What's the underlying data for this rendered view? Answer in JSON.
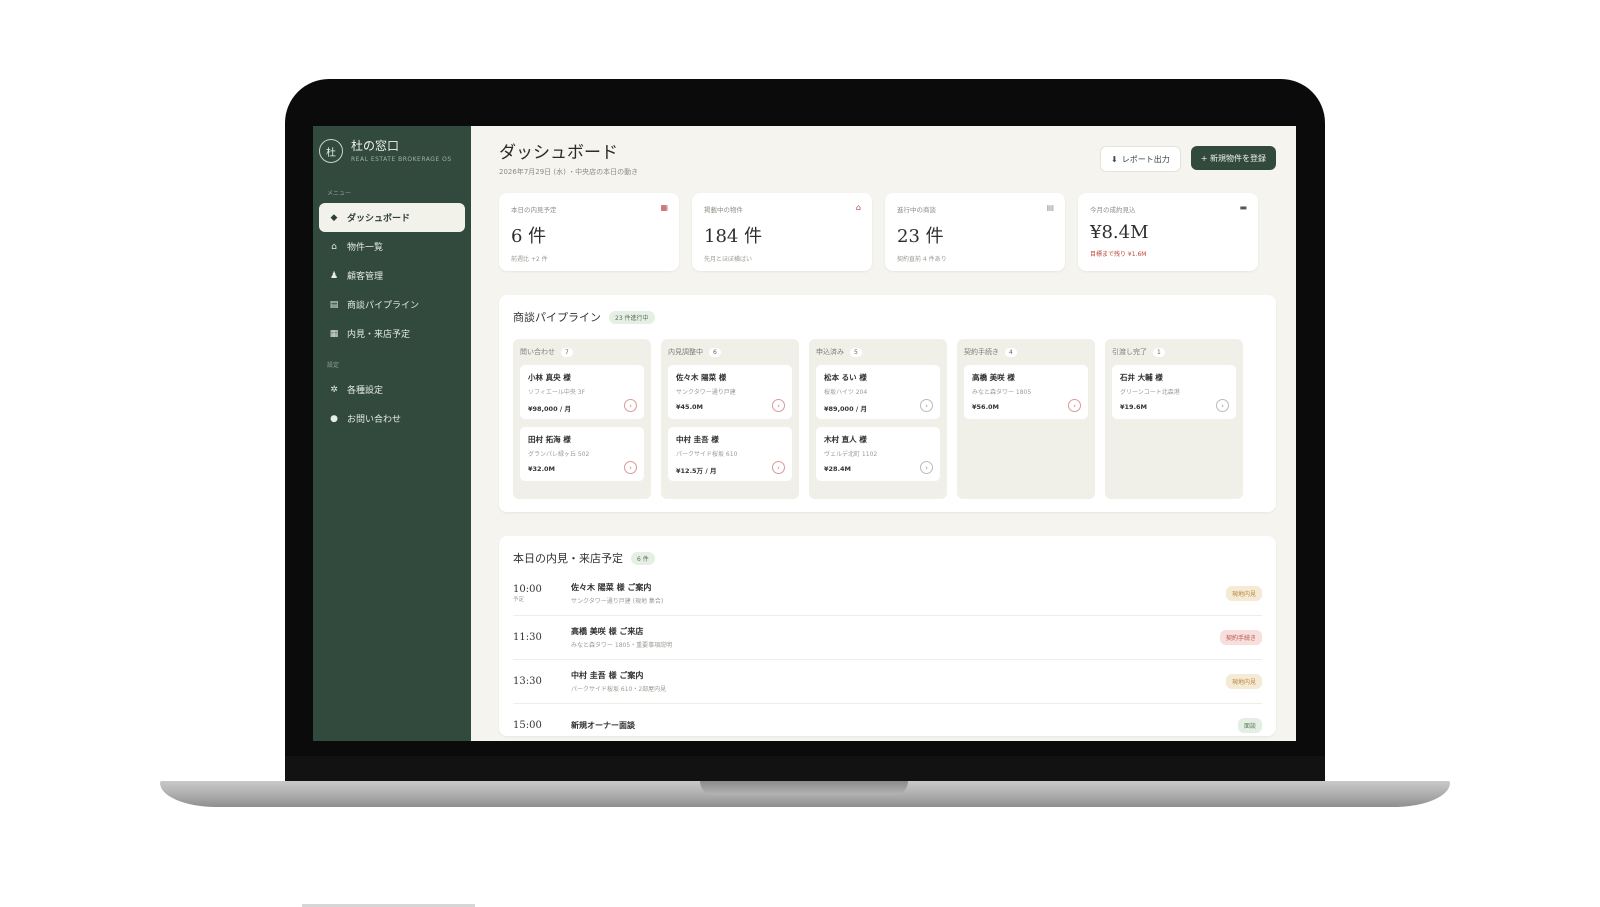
{
  "brand": {
    "name": "杜の窓口",
    "logo_char": "杜",
    "subtitle": "REAL ESTATE BROKERAGE OS"
  },
  "sidebar": {
    "section_menu": "メニュー",
    "section_other": "設定",
    "items": [
      {
        "label": "ダッシュボード",
        "icon": "◆"
      },
      {
        "label": "物件一覧",
        "icon": "⌂"
      },
      {
        "label": "顧客管理",
        "icon": "♟"
      },
      {
        "label": "商談パイプライン",
        "icon": "▤"
      },
      {
        "label": "内見・来店予定",
        "icon": "▦"
      }
    ],
    "other_items": [
      {
        "label": "各種設定",
        "icon": "✲"
      },
      {
        "label": "お問い合わせ",
        "icon": "●"
      }
    ]
  },
  "header": {
    "title": "ダッシュボード",
    "subtitle": "2026年7月29日 (水) ・中央店の本日の動き",
    "report_button": "レポート出力",
    "new_button": "+ 新規物件を登録"
  },
  "kpis": [
    {
      "label": "本日の内見予定",
      "value": "6 件",
      "note": "前週比 +2 件",
      "alert": false
    },
    {
      "label": "掲載中の物件",
      "value": "184 件",
      "note": "先月とほぼ横ばい",
      "alert": false
    },
    {
      "label": "進行中の商談",
      "value": "23 件",
      "note": "契約直前 4 件あり",
      "alert": false
    },
    {
      "label": "今月の成約見込",
      "value": "¥8.4M",
      "note": "目標まで残り ¥1.6M",
      "alert": true
    }
  ],
  "pipeline": {
    "title": "商談パイプライン",
    "badge": "23 件進行中",
    "columns": [
      {
        "name": "問い合わせ",
        "count": "7",
        "deals": [
          {
            "name": "小林 真央 様",
            "property": "ソフィエール中央 3F",
            "price": "¥98,000 / 月"
          },
          {
            "name": "田村 拓海 様",
            "property": "グランパレ緑ヶ丘 502",
            "price": "¥32.0M"
          }
        ]
      },
      {
        "name": "内見調整中",
        "count": "6",
        "deals": [
          {
            "name": "佐々木 陽菜 様",
            "property": "サンクタワー通り戸建",
            "price": "¥45.0M"
          },
          {
            "name": "中村 圭吾 様",
            "property": "パークサイド桜坂 610",
            "price": "¥12.5万 / 月"
          }
        ]
      },
      {
        "name": "申込済み",
        "count": "5",
        "deals": [
          {
            "name": "松本 るい 様",
            "property": "桜坂ハイツ 204",
            "price": "¥89,000 / 月"
          },
          {
            "name": "木村 直人 様",
            "property": "ヴェルデ北町 1102",
            "price": "¥28.4M"
          }
        ]
      },
      {
        "name": "契約手続き",
        "count": "4",
        "deals": [
          {
            "name": "高橋 美咲 様",
            "property": "みなと森タワー 1805",
            "price": "¥56.0M"
          }
        ]
      },
      {
        "name": "引渡し完了",
        "count": "1",
        "deals": [
          {
            "name": "石井 大輔 様",
            "property": "グリーンコート北森港",
            "price": "¥19.6M"
          }
        ]
      }
    ]
  },
  "schedule": {
    "title": "本日の内見・来店予定",
    "badge": "6 件",
    "items": [
      {
        "time": "10:00",
        "sub": "予定",
        "title": "佐々木 陽菜 様 ご案内",
        "detail": "サンクタワー通り戸建 (現地 集合)",
        "tag": "現地内見",
        "tag_type": "gold"
      },
      {
        "time": "11:30",
        "sub": "",
        "title": "高橋 美咲 様 ご来店",
        "detail": "みなと森タワー 1805・重要事項説明",
        "tag": "契約手続き",
        "tag_type": "red"
      },
      {
        "time": "13:30",
        "sub": "",
        "title": "中村 圭吾 様 ご案内",
        "detail": "パークサイド桜坂 610・2部屋内見",
        "tag": "現地内見",
        "tag_type": "gold"
      },
      {
        "time": "15:00",
        "sub": "",
        "title": "新規オーナー面談",
        "detail": "",
        "tag": "面談",
        "tag_type": "green"
      }
    ]
  }
}
